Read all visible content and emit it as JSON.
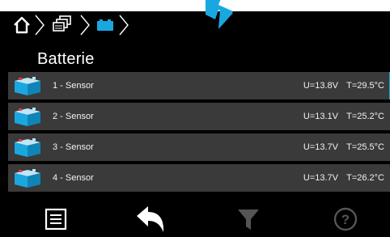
{
  "title": "Batterie",
  "breadcrumb": {
    "items": [
      {
        "name": "home-icon"
      },
      {
        "name": "pages-icon"
      },
      {
        "name": "battery-icon"
      }
    ]
  },
  "sensors": [
    {
      "label": "1 - Sensor",
      "u": "U=13.8V",
      "t": "T=29.5°C"
    },
    {
      "label": "2 - Sensor",
      "u": "U=13.1V",
      "t": "T=25.2°C"
    },
    {
      "label": "3 - Sensor",
      "u": "U=13.7V",
      "t": "T=25.5°C"
    },
    {
      "label": "4 - Sensor",
      "u": "U=13.7V",
      "t": "T=26.2°C"
    }
  ],
  "footer": {
    "buttons": [
      {
        "name": "menu-icon",
        "enabled": true
      },
      {
        "name": "back-icon",
        "enabled": true
      },
      {
        "name": "filter-icon",
        "enabled": false
      },
      {
        "name": "help-icon",
        "enabled": false
      }
    ]
  },
  "colors": {
    "background": "#000000",
    "row": "#3a3a3a",
    "accent": "#1aa7e0",
    "disabled": "#555555"
  }
}
